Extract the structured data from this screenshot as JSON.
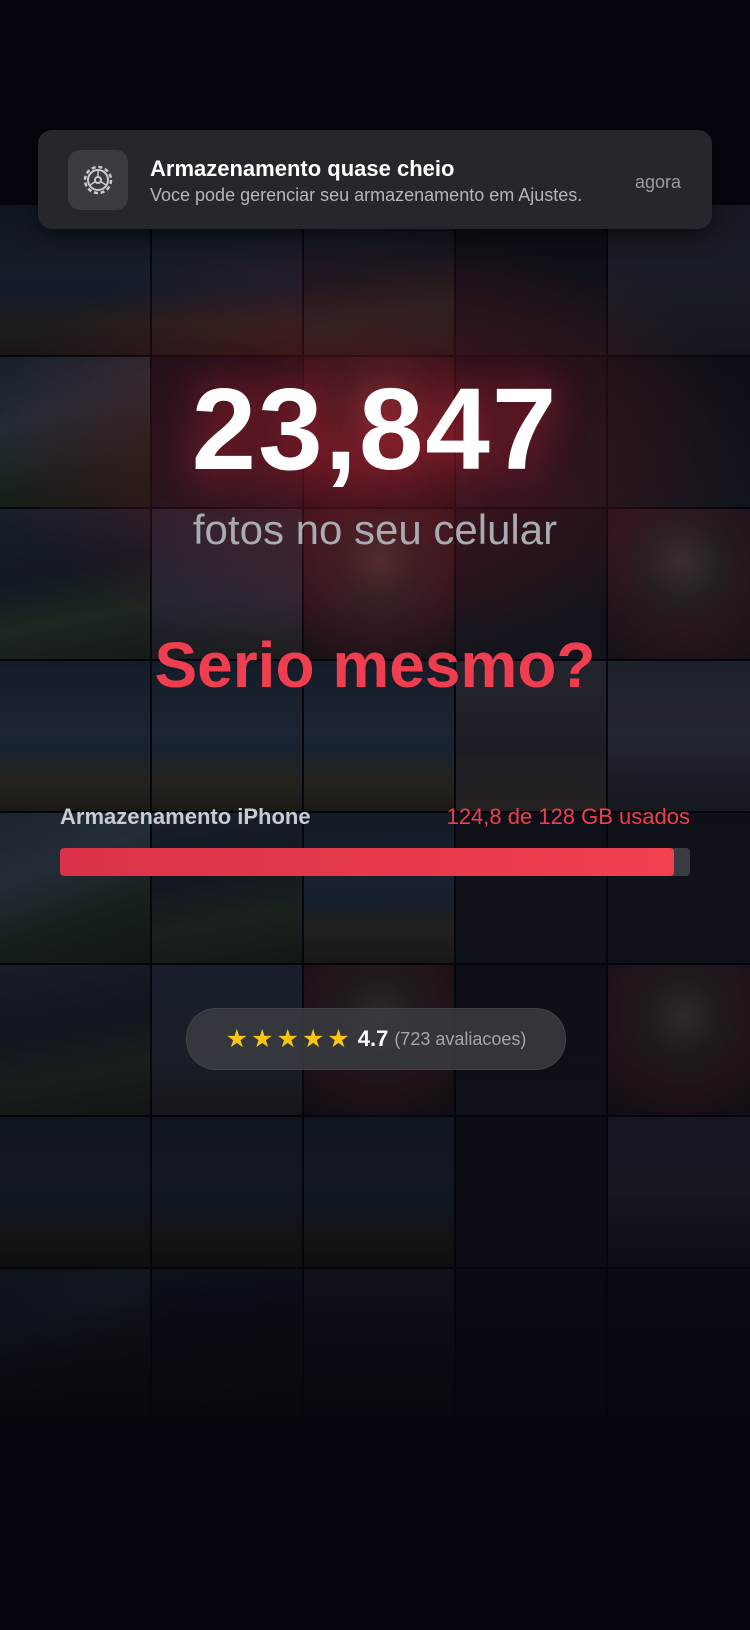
{
  "notification": {
    "title": "Armazenamento quase cheio",
    "body": "Voce pode gerenciar seu armazenamento em Ajustes.",
    "time": "agora",
    "icon": "gear-icon"
  },
  "hero": {
    "count": "23,847",
    "subtitle": "fotos no seu celular",
    "headline": "Serio mesmo?"
  },
  "storage": {
    "label": "Armazenamento iPhone",
    "usage_text": "124,8 de 128 GB usados",
    "used_gb": 124.8,
    "total_gb": 128,
    "bar_color": "#ef3e4f"
  },
  "rating": {
    "stars": 5,
    "value": "4.7",
    "count_text": "(723 avaliacoes)",
    "star_color": "#f7c512"
  },
  "colors": {
    "background": "#05060d",
    "accent": "#ef3e4f",
    "text": "#ffffff"
  }
}
